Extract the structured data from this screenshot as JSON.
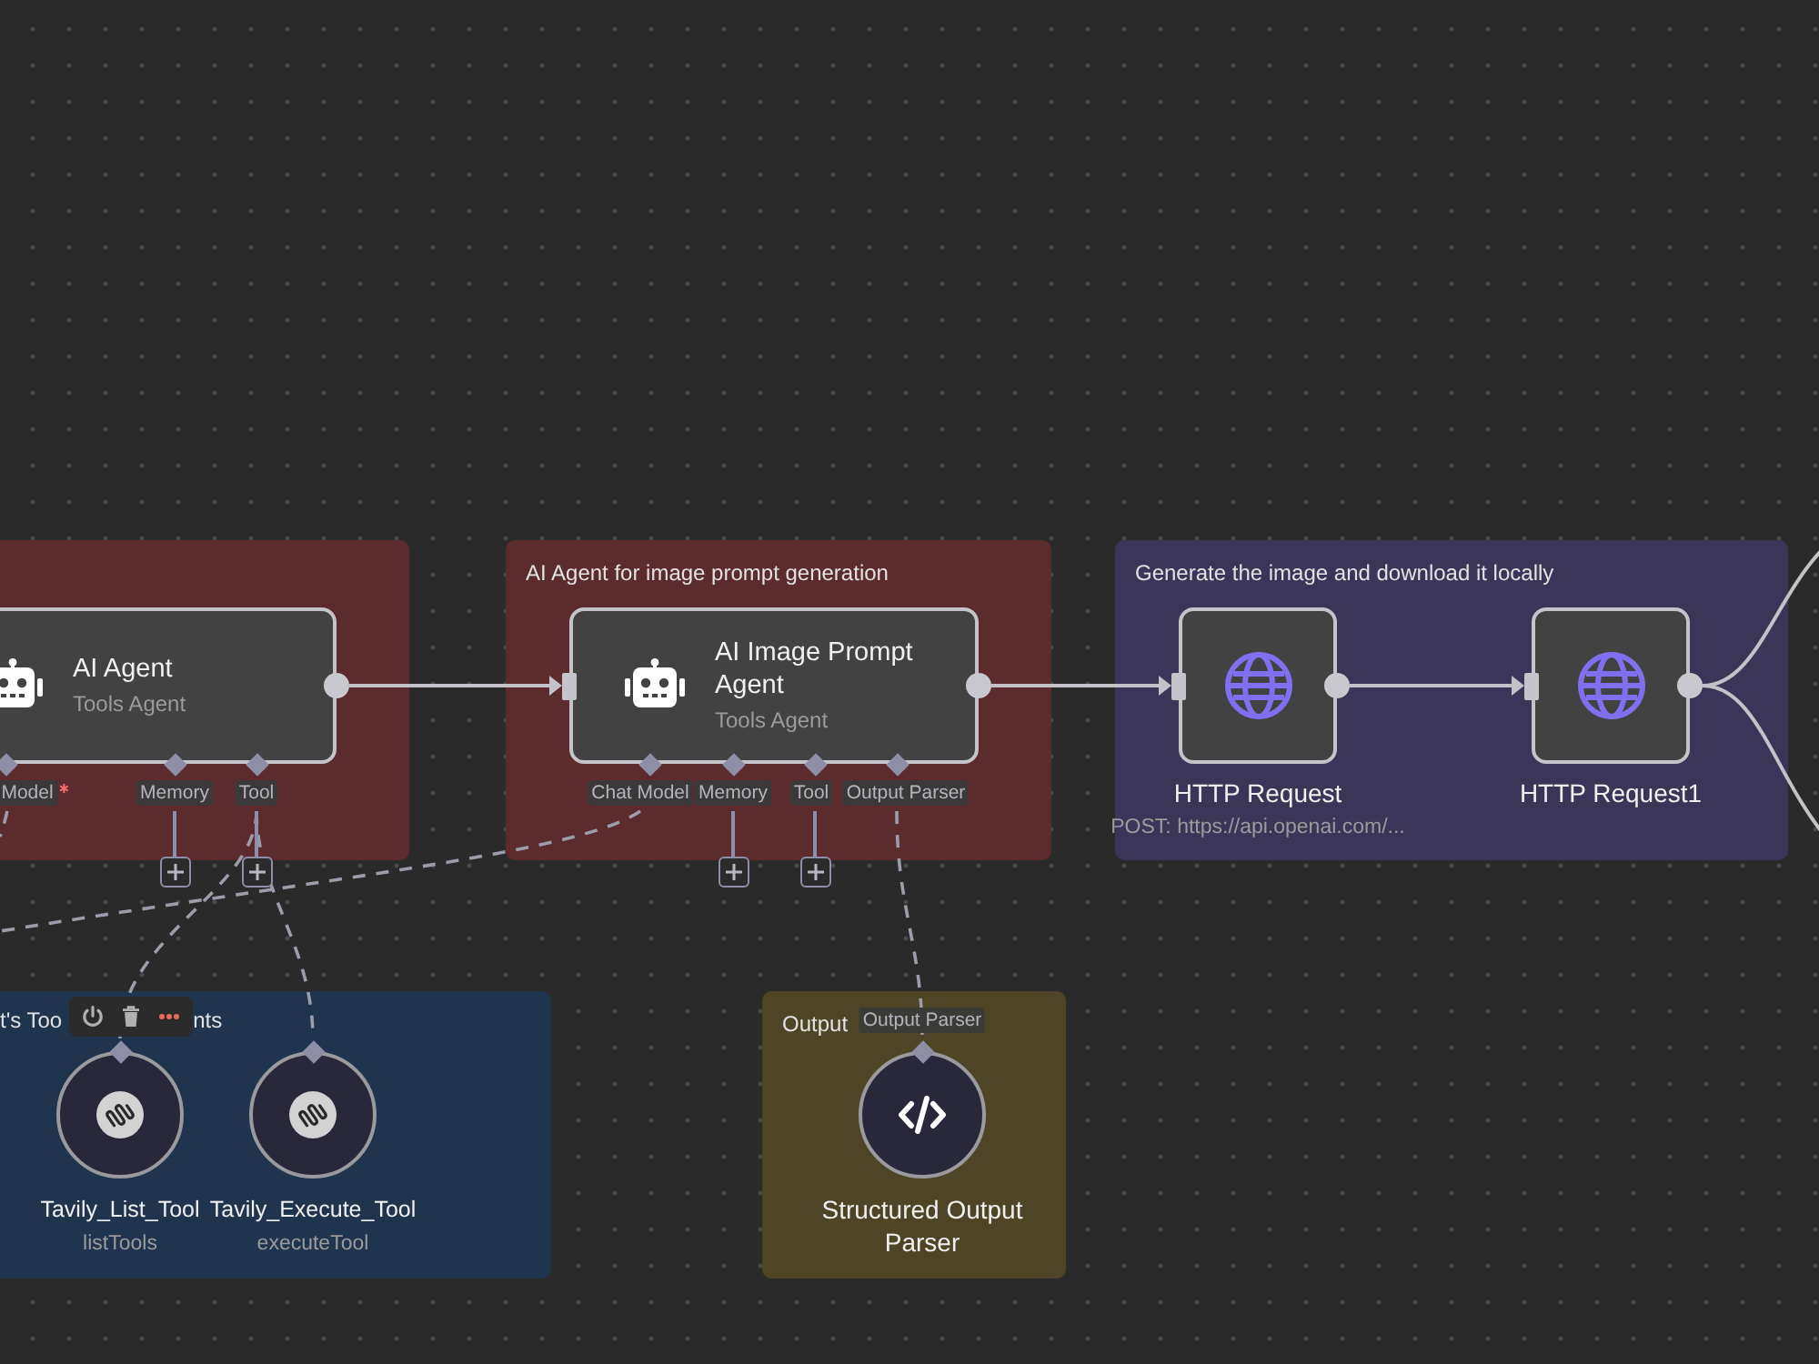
{
  "canvas": {
    "sticky_notes": [
      {
        "color": "#5b2b2e"
      },
      {
        "title": "AI Agent for image prompt generation",
        "color": "#5b2b2e"
      },
      {
        "title": "Generate the image and download it locally",
        "color": "#3b3657"
      },
      {
        "title_start": "t's Too",
        "title_end": "nts",
        "color": "#21344e"
      },
      {
        "title": "Output",
        "color": "#4e4527"
      }
    ],
    "nodes": [
      {
        "kind": "agent",
        "title": "AI Agent",
        "subtitle": "Tools Agent",
        "hovered": false,
        "inputs": [
          {
            "label": "Model",
            "required": true,
            "addable": false
          },
          {
            "label": "Memory",
            "required": false,
            "addable": true
          },
          {
            "label": "Tool",
            "required": false,
            "addable": true
          }
        ]
      },
      {
        "kind": "agent",
        "title": "AI Image Prompt Agent",
        "subtitle": "Tools Agent",
        "hovered": false,
        "inputs": [
          {
            "label": "Chat Model",
            "required": false,
            "addable": false
          },
          {
            "label": "Memory",
            "required": false,
            "addable": true
          },
          {
            "label": "Tool",
            "required": false,
            "addable": true
          },
          {
            "label": "Output Parser",
            "required": false,
            "addable": false
          }
        ]
      },
      {
        "kind": "http",
        "title": "HTTP Request",
        "subtitle": "POST: https://api.openai.com/...",
        "hovered": false
      },
      {
        "kind": "http",
        "title": "HTTP Request1",
        "hovered": false
      },
      {
        "kind": "tool",
        "title": "Tavily_List_Tool",
        "subtitle": "listTools",
        "hovered": true
      },
      {
        "kind": "tool",
        "title": "Tavily_Execute_Tool",
        "subtitle": "executeTool",
        "hovered": false
      },
      {
        "kind": "parser",
        "title": "Structured Output Parser",
        "output_label": "Output Parser",
        "hovered": false
      }
    ]
  }
}
